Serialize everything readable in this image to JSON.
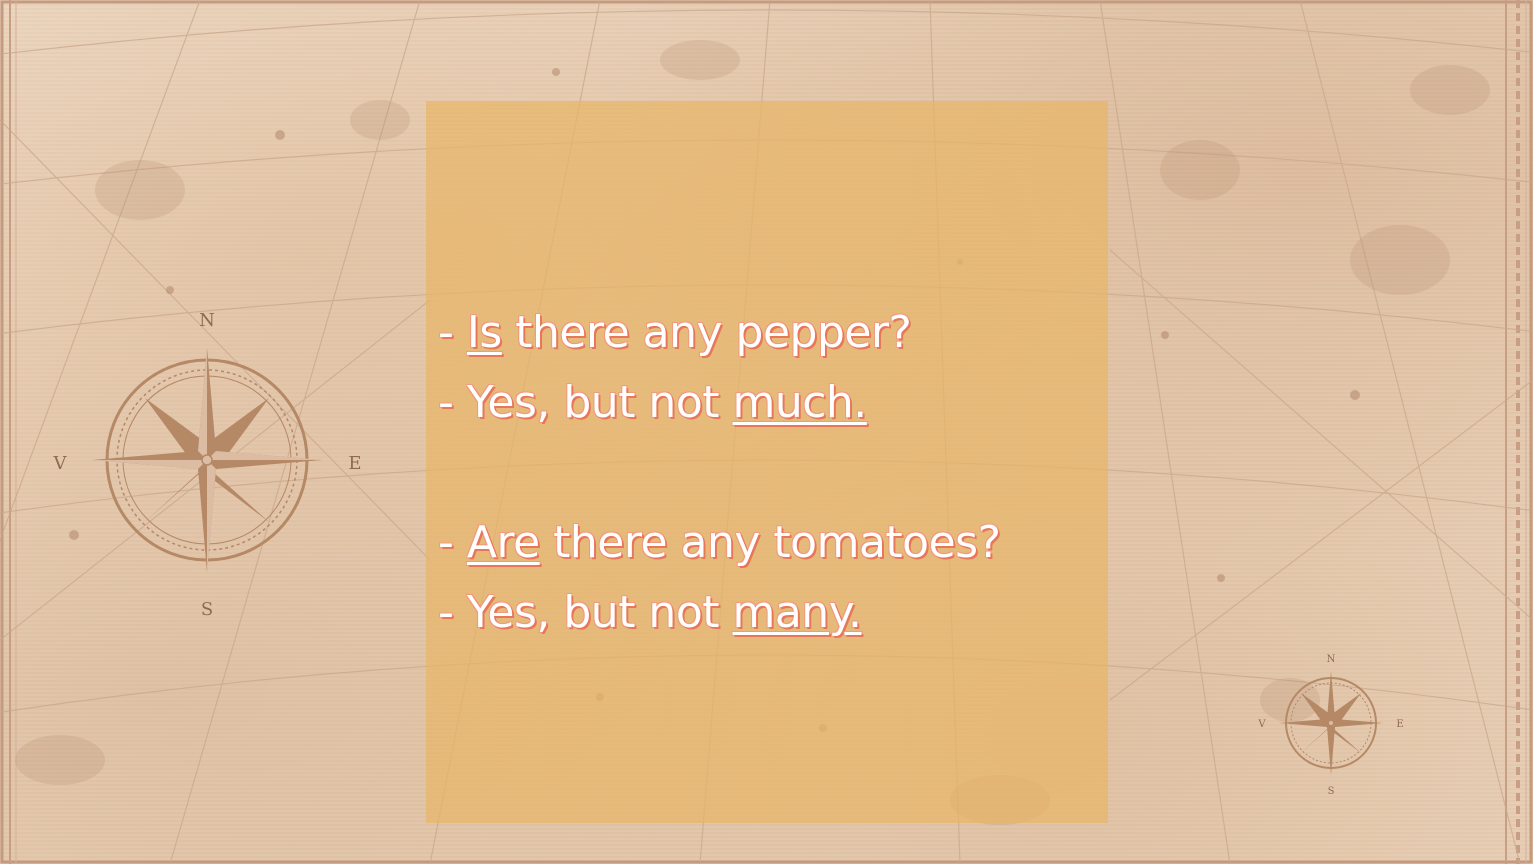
{
  "slide": {
    "lines": [
      {
        "dash": "- ",
        "emph": "Is",
        "rest": " there any pepper?"
      },
      {
        "dash": "- ",
        "pre": "Yes, but not ",
        "emph": "much."
      },
      {
        "dash": "- ",
        "emph": "Are",
        "rest": " there any tomatoes?"
      },
      {
        "dash": "- ",
        "pre": "Yes, but not ",
        "emph": "many."
      }
    ]
  },
  "compass_large": {
    "n": "N",
    "e": "E",
    "s": "S",
    "w": "V"
  },
  "compass_small": {
    "n": "N",
    "e": "E",
    "s": "S",
    "w": "V"
  },
  "colors": {
    "panel": "#e8b668",
    "text": "#ffffff",
    "text_shadow": "#e8775a",
    "compass": "#b58866",
    "background": "#e7cdb2"
  }
}
